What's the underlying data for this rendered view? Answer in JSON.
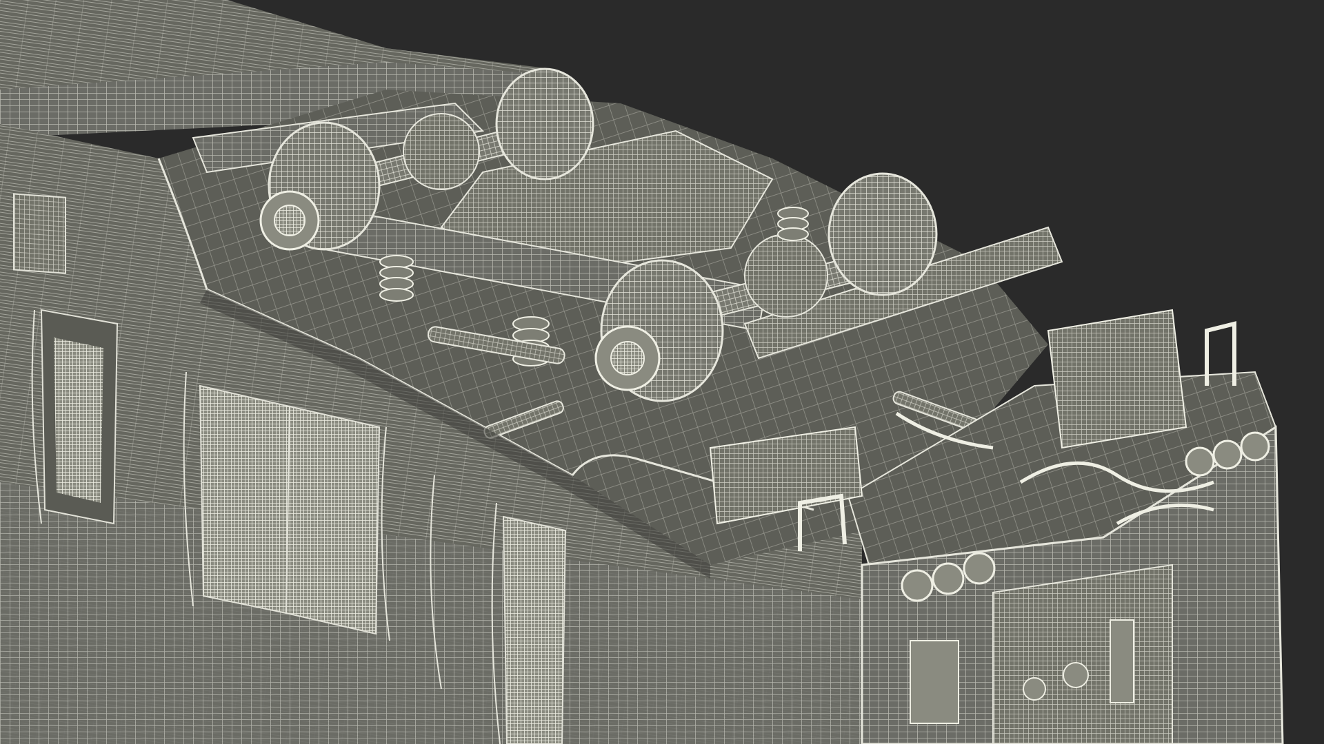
{
  "scene": {
    "background_color": "#2a2a2a",
    "surface_color": "#6b6c66",
    "wire_color": "#d8d8ce",
    "shadow_color": "#4e4f4a",
    "render_mode": "wireframe-on-shaded",
    "subject": "locomotive-underframe-with-bogie"
  }
}
